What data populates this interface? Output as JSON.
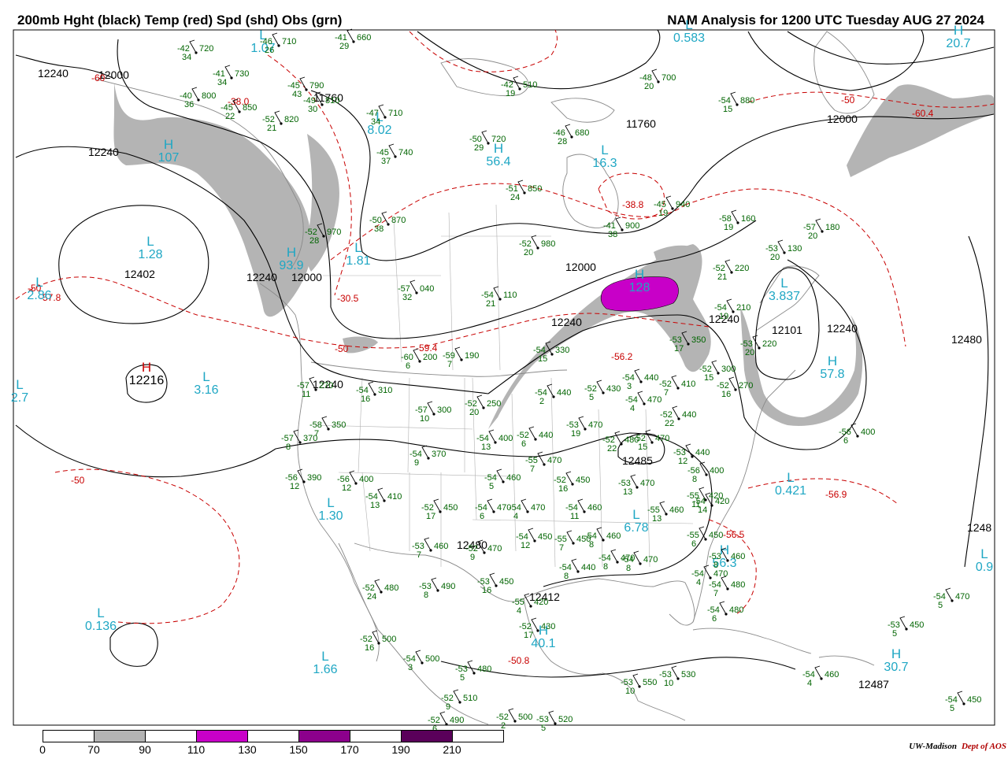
{
  "header": {
    "title_left": "200mb Hght (black) Temp (red) Spd (shd) Obs (grn)",
    "title_right": "NAM Analysis for 1200 UTC Tuesday  AUG 27 2024"
  },
  "legend": {
    "bins": [
      {
        "color": "#ffffff"
      },
      {
        "color": "#b4b4b4"
      },
      {
        "color": "#ffffff"
      },
      {
        "color": "#c800c8"
      },
      {
        "color": "#ffffff"
      },
      {
        "color": "#8c008c"
      },
      {
        "color": "#ffffff"
      },
      {
        "color": "#5a005a"
      },
      {
        "color": "#ffffff"
      }
    ],
    "labels": [
      "0",
      "70",
      "90",
      "110",
      "130",
      "150",
      "170",
      "190",
      "210"
    ]
  },
  "credit": {
    "org": "UW-Madison",
    "dept": "Dept of AOS"
  },
  "colors": {
    "height": "#000000",
    "temp": "#c80000",
    "speed_label": "#1fa7c4",
    "obs": "#006400",
    "jet70": "#b4b4b4",
    "jet110": "#c800c8"
  },
  "height_labels": [
    "12240",
    "12000",
    "12240",
    "12402",
    "12240",
    "12000",
    "11760",
    "11760",
    "12000",
    "12240",
    "12240",
    "12000",
    "12240",
    "12480",
    "12240",
    "12485",
    "12480",
    "12412",
    "12487",
    "12101",
    "1248"
  ],
  "temp_labels": [
    "-60",
    "-50",
    "-57.8",
    "-50",
    "-59.4",
    "-56.2",
    "-38.8",
    "-38.0",
    "-30.5",
    "-50",
    "-50.8",
    "-56.5",
    "-56.9",
    "-50",
    "-60.4"
  ],
  "pressure_centers": [
    {
      "letter": "L",
      "type": "low",
      "value": "2.86"
    },
    {
      "letter": "H",
      "type": "high",
      "value": "107"
    },
    {
      "letter": "L",
      "type": "low",
      "value": "2.7"
    },
    {
      "letter": "L",
      "type": "low",
      "value": "3.16"
    },
    {
      "letter": "H",
      "type": "high",
      "value": "12216"
    },
    {
      "letter": "L",
      "type": "low",
      "value": "1.30"
    },
    {
      "letter": "L",
      "type": "low",
      "value": "0.136"
    },
    {
      "letter": "L",
      "type": "low",
      "value": "1.66"
    },
    {
      "letter": "L",
      "type": "low",
      "value": "8.02"
    },
    {
      "letter": "H",
      "type": "high",
      "value": "56.4"
    },
    {
      "letter": "L",
      "type": "low",
      "value": "16.3"
    },
    {
      "letter": "H",
      "type": "high",
      "value": "128"
    },
    {
      "letter": "H",
      "type": "high",
      "value": "93.9"
    },
    {
      "letter": "L",
      "type": "low",
      "value": "1.81"
    },
    {
      "letter": "H",
      "type": "high",
      "value": "40.1"
    },
    {
      "letter": "L",
      "type": "low",
      "value": "0.421"
    },
    {
      "letter": "H",
      "type": "high",
      "value": "57.8"
    },
    {
      "letter": "H",
      "type": "high",
      "value": "56.3"
    },
    {
      "letter": "H",
      "type": "high",
      "value": "30.7"
    },
    {
      "letter": "L",
      "type": "low",
      "value": "0.583"
    },
    {
      "letter": "L",
      "type": "low",
      "value": "1.07"
    },
    {
      "letter": "H",
      "type": "high",
      "value": "20.7"
    },
    {
      "letter": "L",
      "type": "low",
      "value": "6.78"
    },
    {
      "letter": "L",
      "type": "low",
      "value": "3.837"
    },
    {
      "letter": "L",
      "type": "low",
      "value": "1.28"
    },
    {
      "letter": "L",
      "type": "low",
      "value": "0.9"
    }
  ],
  "observations": [
    {
      "t": "-42",
      "h": "720",
      "s": "34"
    },
    {
      "t": "-46",
      "h": "710",
      "s": "26"
    },
    {
      "t": "-41",
      "h": "660",
      "s": "29"
    },
    {
      "t": "-41",
      "h": "730",
      "s": "34"
    },
    {
      "t": "-45",
      "h": "790",
      "s": "43"
    },
    {
      "t": "-40",
      "h": "800",
      "s": "36"
    },
    {
      "t": "-49",
      "h": "810",
      "s": "30"
    },
    {
      "t": "-45",
      "h": "850",
      "s": "22"
    },
    {
      "t": "-52",
      "h": "820",
      "s": "21"
    },
    {
      "t": "-47",
      "h": "710",
      "s": "34"
    },
    {
      "t": "-45",
      "h": "740",
      "s": "37"
    },
    {
      "t": "-50",
      "h": "720",
      "s": "29"
    },
    {
      "t": "-42",
      "h": "510",
      "s": "19"
    },
    {
      "t": "-46",
      "h": "680",
      "s": "28"
    },
    {
      "t": "-48",
      "h": "700",
      "s": "20"
    },
    {
      "t": "-54",
      "h": "880",
      "s": "15"
    },
    {
      "t": "-51",
      "h": "850",
      "s": "24"
    },
    {
      "t": "-45",
      "h": "940",
      "s": "19"
    },
    {
      "t": "-41",
      "h": "900",
      "s": "38"
    },
    {
      "t": "-58",
      "h": "160",
      "s": "19"
    },
    {
      "t": "-57",
      "h": "180",
      "s": "20"
    },
    {
      "t": "-52",
      "h": "970",
      "s": "28"
    },
    {
      "t": "-50",
      "h": "870",
      "s": "38"
    },
    {
      "t": "-52",
      "h": "980",
      "s": "20"
    },
    {
      "t": "-53",
      "h": "130",
      "s": "20"
    },
    {
      "t": "-52",
      "h": "220",
      "s": "21"
    },
    {
      "t": "-57",
      "h": "040",
      "s": "32"
    },
    {
      "t": "-54",
      "h": "110",
      "s": "21"
    },
    {
      "t": "-54",
      "h": "210",
      "s": "19"
    },
    {
      "t": "-53",
      "h": "220",
      "s": "20"
    },
    {
      "t": "-60",
      "h": "200",
      "s": "6"
    },
    {
      "t": "-59",
      "h": "190",
      "s": "7"
    },
    {
      "t": "-54",
      "h": "330",
      "s": "15"
    },
    {
      "t": "-53",
      "h": "350",
      "s": "17"
    },
    {
      "t": "-52",
      "h": "300",
      "s": "15"
    },
    {
      "t": "-52",
      "h": "270",
      "s": "16"
    },
    {
      "t": "-57",
      "h": "270",
      "s": "11"
    },
    {
      "t": "-54",
      "h": "310",
      "s": "16"
    },
    {
      "t": "-54",
      "h": "440",
      "s": "2"
    },
    {
      "t": "-52",
      "h": "430",
      "s": "5"
    },
    {
      "t": "-54",
      "h": "440",
      "s": "3"
    },
    {
      "t": "-54",
      "h": "470",
      "s": "4"
    },
    {
      "t": "-52",
      "h": "410",
      "s": "7"
    },
    {
      "t": "-52",
      "h": "440",
      "s": "22"
    },
    {
      "t": "-58",
      "h": "350",
      "s": "7"
    },
    {
      "t": "-57",
      "h": "300",
      "s": "10"
    },
    {
      "t": "-52",
      "h": "250",
      "s": "20"
    },
    {
      "t": "-57",
      "h": "370",
      "s": "8"
    },
    {
      "t": "-54",
      "h": "370",
      "s": "9"
    },
    {
      "t": "-54",
      "h": "400",
      "s": "13"
    },
    {
      "t": "-52",
      "h": "440",
      "s": "6"
    },
    {
      "t": "-53",
      "h": "470",
      "s": "19"
    },
    {
      "t": "-52",
      "h": "480",
      "s": "22"
    },
    {
      "t": "-52",
      "h": "470",
      "s": "15"
    },
    {
      "t": "-53",
      "h": "440",
      "s": "12"
    },
    {
      "t": "-56",
      "h": "390",
      "s": "12"
    },
    {
      "t": "-56",
      "h": "400",
      "s": "12"
    },
    {
      "t": "-54",
      "h": "410",
      "s": "13"
    },
    {
      "t": "-55",
      "h": "470",
      "s": "7"
    },
    {
      "t": "-54",
      "h": "460",
      "s": "5"
    },
    {
      "t": "-52",
      "h": "450",
      "s": "16"
    },
    {
      "t": "-53",
      "h": "470",
      "s": "13"
    },
    {
      "t": "-56",
      "h": "400",
      "s": "8"
    },
    {
      "t": "-55",
      "h": "420",
      "s": "11"
    },
    {
      "t": "-52",
      "h": "450",
      "s": "17"
    },
    {
      "t": "-54",
      "h": "470",
      "s": "6"
    },
    {
      "t": "-54",
      "h": "470",
      "s": "4"
    },
    {
      "t": "-54",
      "h": "460",
      "s": "11"
    },
    {
      "t": "-55",
      "h": "460",
      "s": "13"
    },
    {
      "t": "-54",
      "h": "420",
      "s": "14"
    },
    {
      "t": "-55",
      "h": "450",
      "s": "6"
    },
    {
      "t": "-53",
      "h": "460",
      "s": "8"
    },
    {
      "t": "-54",
      "h": "450",
      "s": "12"
    },
    {
      "t": "-55",
      "h": "450",
      "s": "7"
    },
    {
      "t": "-54",
      "h": "460",
      "s": "8"
    },
    {
      "t": "-54",
      "h": "440",
      "s": "8"
    },
    {
      "t": "-54",
      "h": "470",
      "s": "8"
    },
    {
      "t": "-54",
      "h": "470",
      "s": "8"
    },
    {
      "t": "-53",
      "h": "460",
      "s": "7"
    },
    {
      "t": "-52",
      "h": "470",
      "s": "9"
    },
    {
      "t": "-52",
      "h": "480",
      "s": "24"
    },
    {
      "t": "-53",
      "h": "490",
      "s": "8"
    },
    {
      "t": "-53",
      "h": "450",
      "s": "16"
    },
    {
      "t": "-55",
      "h": "420",
      "s": "4"
    },
    {
      "t": "-54",
      "h": "480",
      "s": "7"
    },
    {
      "t": "-54",
      "h": "480",
      "s": "6"
    },
    {
      "t": "-54",
      "h": "470",
      "s": "4"
    },
    {
      "t": "-52",
      "h": "500",
      "s": "16"
    },
    {
      "t": "-52",
      "h": "430",
      "s": "17"
    },
    {
      "t": "-54",
      "h": "500",
      "s": "3"
    },
    {
      "t": "-53",
      "h": "480",
      "s": "5"
    },
    {
      "t": "-52",
      "h": "510",
      "s": "9"
    },
    {
      "t": "-52",
      "h": "490",
      "s": "6"
    },
    {
      "t": "-52",
      "h": "500",
      "s": "2"
    },
    {
      "t": "-53",
      "h": "520",
      "s": "5"
    },
    {
      "t": "-53",
      "h": "550",
      "s": "10"
    },
    {
      "t": "-53",
      "h": "530",
      "s": "10"
    },
    {
      "t": "-54",
      "h": "460",
      "s": "4"
    },
    {
      "t": "-53",
      "h": "450",
      "s": "5"
    },
    {
      "t": "-54",
      "h": "450",
      "s": "5"
    },
    {
      "t": "-56",
      "h": "400",
      "s": "6"
    },
    {
      "t": "-54",
      "h": "470",
      "s": "5"
    }
  ]
}
